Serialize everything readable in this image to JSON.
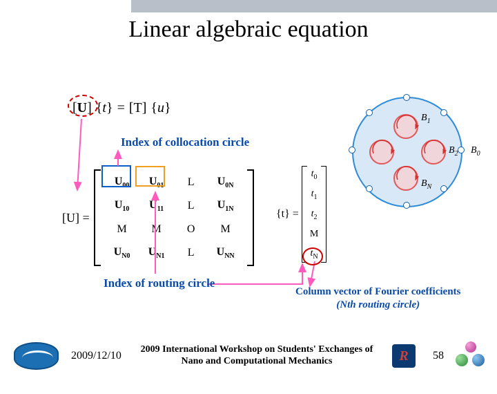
{
  "title": "Linear algebraic equation",
  "top_equation": {
    "lhs_u": "U",
    "t": "t",
    "eq": "=",
    "T": "T",
    "u": "u"
  },
  "labels": {
    "collocation": "Index of collocation circle",
    "routing": "Index of routing circle",
    "column_vector_l1": "Column vector of Fourier coefficients",
    "column_vector_l2": "(Nth routing circle)"
  },
  "matrix": {
    "left_label": "[U] =",
    "cells": [
      [
        "U00",
        "U01",
        "L",
        "U0N"
      ],
      [
        "U10",
        "U11",
        "L",
        "U1N"
      ],
      [
        "M",
        "M",
        "O",
        "M"
      ],
      [
        "UN0",
        "UN1",
        "L",
        "UNN"
      ]
    ]
  },
  "tvector": {
    "left_label": "{t} =",
    "items": [
      "t0",
      "t1",
      "t2",
      "M",
      "tN"
    ]
  },
  "diagram": {
    "labels": {
      "b0": "B0",
      "b1": "B1",
      "b2": "B2",
      "bn": "BN"
    }
  },
  "footer": {
    "date": "2009/12/10",
    "workshop_l1": "2009 International Workshop on Students' Exchanges of",
    "workshop_l2": "Nano and Computational Mechanics",
    "page": "58",
    "rlogo_letter": "R"
  }
}
